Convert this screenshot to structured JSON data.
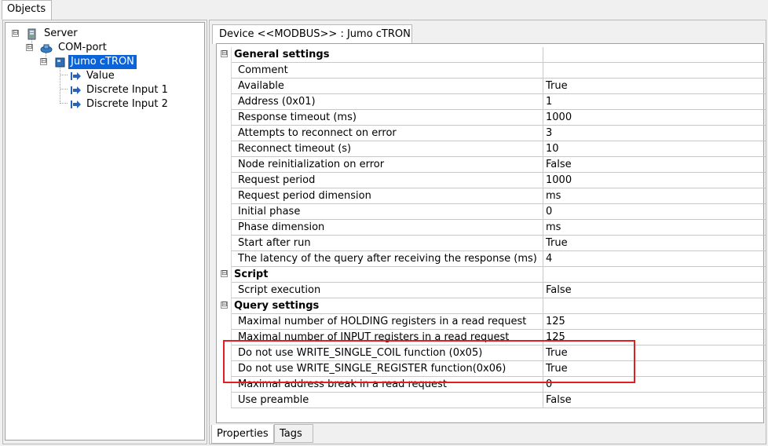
{
  "objects_tab": {
    "label": "Objects"
  },
  "tree": {
    "items": [
      {
        "label": "Server",
        "icon": "server-icon"
      },
      {
        "label": "COM-port",
        "icon": "com-port-icon"
      },
      {
        "label": "Jumo cTRON",
        "icon": "device-icon",
        "selected": true
      },
      {
        "label": "Value",
        "icon": "tag-arrow-icon"
      },
      {
        "label": "Discrete Input 1",
        "icon": "tag-arrow-icon"
      },
      {
        "label": "Discrete Input 2",
        "icon": "tag-arrow-icon"
      }
    ],
    "expander_minus": "⊟"
  },
  "device_tab": {
    "label": "Device <<MODBUS>> : Jumo cTRON"
  },
  "properties": {
    "rows": [
      {
        "name": "General settings",
        "value": "",
        "section": true
      },
      {
        "name": "Comment",
        "value": ""
      },
      {
        "name": "Available",
        "value": "True"
      },
      {
        "name": "Address   (0x01)",
        "value": "1"
      },
      {
        "name": "Response timeout (ms)",
        "value": "1000"
      },
      {
        "name": "Attempts to reconnect on error",
        "value": "3"
      },
      {
        "name": "Reconnect timeout (s)",
        "value": "10"
      },
      {
        "name": "Node reinitialization on error",
        "value": "False"
      },
      {
        "name": "Request period",
        "value": "1000"
      },
      {
        "name": "Request period dimension",
        "value": "ms"
      },
      {
        "name": "Initial phase",
        "value": "0"
      },
      {
        "name": "Phase dimension",
        "value": "ms"
      },
      {
        "name": "Start after run",
        "value": "True"
      },
      {
        "name": "The latency of the query after receiving the response (ms)",
        "value": "4"
      },
      {
        "name": "Script",
        "value": "",
        "section": true
      },
      {
        "name": "Script execution",
        "value": "False"
      },
      {
        "name": "Query settings",
        "value": "",
        "section": true
      },
      {
        "name": "Maximal number of HOLDING registers in a read request",
        "value": "125"
      },
      {
        "name": "Maximal number of INPUT registers in a read request",
        "value": "125"
      },
      {
        "name": "Do not use WRITE_SINGLE_COIL function (0x05)",
        "value": "True"
      },
      {
        "name": "Do not use WRITE_SINGLE_REGISTER function(0x06)",
        "value": "True"
      },
      {
        "name": "Maximal address break in a read request",
        "value": "0"
      },
      {
        "name": "Use preamble",
        "value": "False"
      }
    ]
  },
  "bottom_tabs": [
    {
      "label": "Properties",
      "active": true
    },
    {
      "label": "Tags",
      "active": false
    }
  ],
  "colors": {
    "selection": "#0a63d8",
    "highlight_box": "#e02020",
    "tag_arrow": "#2a62b8"
  }
}
